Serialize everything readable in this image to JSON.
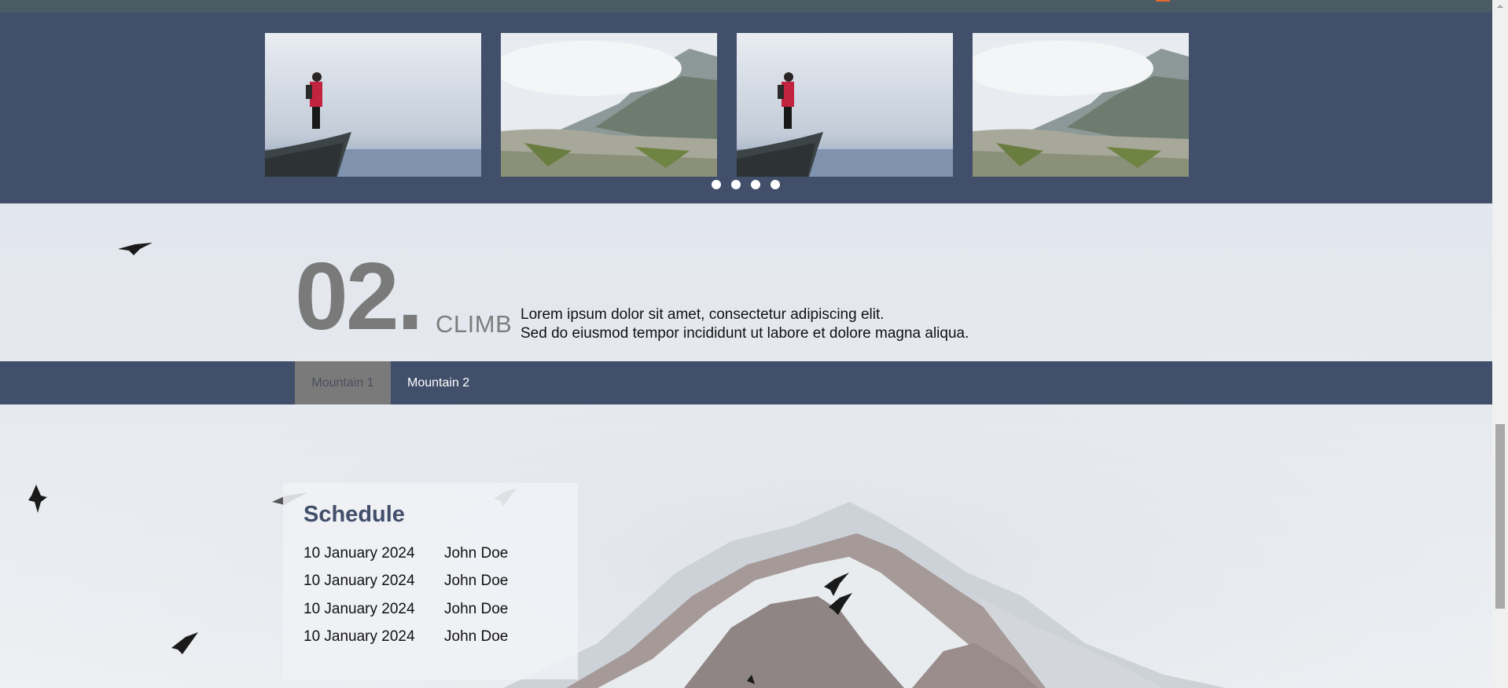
{
  "gallery": {
    "images": [
      {
        "name": "climber-on-rock"
      },
      {
        "name": "misty-valley"
      },
      {
        "name": "climber-on-rock"
      },
      {
        "name": "misty-valley"
      }
    ],
    "dot_count": 4
  },
  "section": {
    "number": "02.",
    "label": "CLIMB",
    "text_line1": "Lorem ipsum dolor sit amet, consectetur adipiscing elit.",
    "text_line2": "Sed do eiusmod tempor incididunt ut labore et dolore magna aliqua."
  },
  "tabs": [
    {
      "label": "Mountain 1",
      "active": true
    },
    {
      "label": "Mountain 2",
      "active": false
    }
  ],
  "schedule": {
    "title": "Schedule",
    "rows": [
      {
        "date": "10 January 2024",
        "name": "John Doe"
      },
      {
        "date": "10 January 2024",
        "name": "John Doe"
      },
      {
        "date": "10 January 2024",
        "name": "John Doe"
      },
      {
        "date": "10 January 2024",
        "name": "John Doe"
      }
    ]
  },
  "colors": {
    "navy": "#414f6a",
    "tab_active": "#7a7a7a",
    "number_gray": "#7a7a7a",
    "accent": "#e0692b"
  }
}
